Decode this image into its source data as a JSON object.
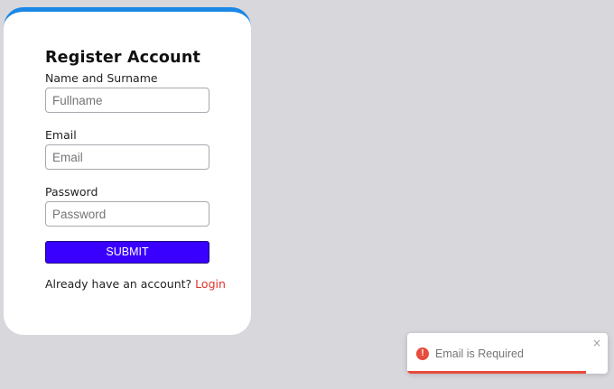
{
  "form": {
    "title": "Register Account",
    "fullname": {
      "label": "Name and Surname",
      "placeholder": "Fullname",
      "value": ""
    },
    "email": {
      "label": "Email",
      "placeholder": "Email",
      "value": ""
    },
    "password": {
      "label": "Password",
      "placeholder": "Password",
      "value": ""
    },
    "submit_label": "SUBMIT",
    "footer_text": "Already have an account?",
    "login_link": "Login"
  },
  "toast": {
    "icon": "error-icon",
    "icon_glyph": "!",
    "message": "Email is Required",
    "close_glyph": "×",
    "progress_remaining": 0.89,
    "color": "#e74c3c"
  },
  "colors": {
    "accent_top": "#1a88e6",
    "submit_bg": "#3a00ff",
    "link": "#e0322b",
    "background": "#d8d7dc"
  }
}
